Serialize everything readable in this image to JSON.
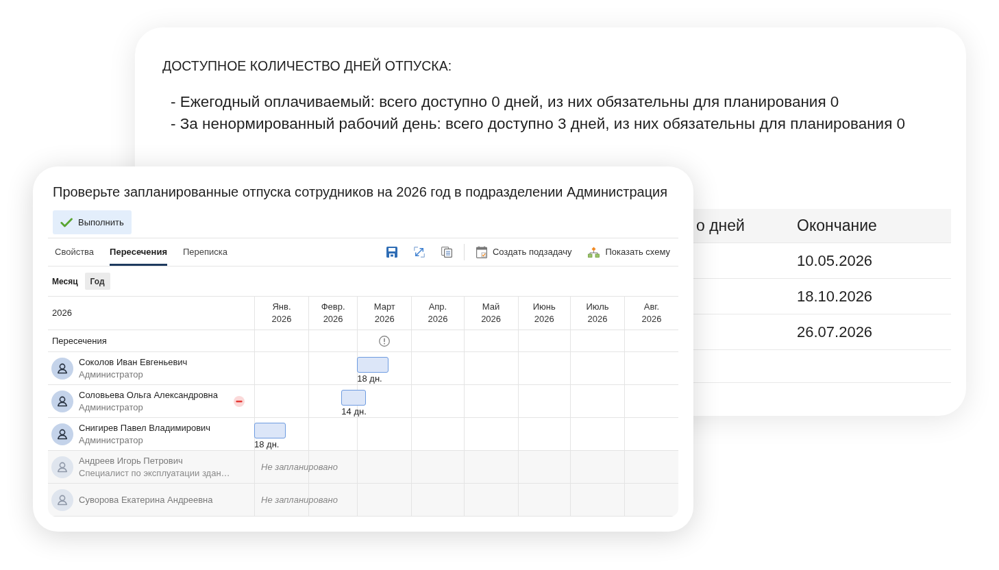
{
  "background_card": {
    "heading": "ДОСТУПНОЕ КОЛИЧЕСТВО ДНЕЙ ОТПУСКА:",
    "lines": [
      "- Ежегодный оплачиваемый: всего доступно 0 дней, из них обязательны для планирования 0",
      "- За ненормированный рабочий день: всего доступно 3 дней, из них обязательны для планирования 0"
    ],
    "table": {
      "columns": [
        "о дней",
        "Окончание"
      ],
      "rows": [
        {
          "ending": "10.05.2026"
        },
        {
          "ending": "18.10.2026"
        },
        {
          "ending": "26.07.2026"
        }
      ]
    }
  },
  "task_card": {
    "title": "Проверьте запланированные отпуска сотрудников на 2026 год в подразделении Администрация",
    "complete_button": "Выполнить",
    "tabs": [
      {
        "label": "Свойства",
        "selected": false
      },
      {
        "label": "Пересечения",
        "selected": true
      },
      {
        "label": "Переписка",
        "selected": false
      }
    ],
    "toolbar_actions": [
      {
        "label": "Создать подзадачу"
      },
      {
        "label": "Показать схему"
      }
    ],
    "view_modes": [
      {
        "label": "Месяц",
        "selected": false
      },
      {
        "label": "Год",
        "selected": true
      }
    ],
    "grid": {
      "year": "2026",
      "months": [
        {
          "lines": [
            "Янв.",
            "2026"
          ]
        },
        {
          "lines": [
            "Февр.",
            "2026"
          ]
        },
        {
          "lines": [
            "Март",
            "2026"
          ]
        },
        {
          "lines": [
            "Апр.",
            "2026"
          ]
        },
        {
          "lines": [
            "Май",
            "2026"
          ]
        },
        {
          "lines": [
            "Июнь",
            "2026"
          ]
        },
        {
          "lines": [
            "Июль",
            "2026"
          ]
        },
        {
          "lines": [
            "Авг.",
            "2026"
          ]
        }
      ],
      "intersections": {
        "label": "Пересечения",
        "cells": [
          {
            "warning": false
          },
          {
            "warning": false
          },
          {
            "warning": true
          },
          {
            "warning": false
          },
          {
            "warning": false
          },
          {
            "warning": false
          },
          {
            "warning": false
          },
          {
            "warning": false
          }
        ]
      },
      "employees": [
        {
          "name": "Соколов Иван Евгеньевич",
          "role": "Администратор",
          "disabled": false,
          "excluded": false,
          "vacations": [
            {
              "label": "18 дн."
            }
          ]
        },
        {
          "name": "Соловьева Ольга Александровна",
          "role": "Администратор",
          "disabled": false,
          "excluded": true,
          "vacations": [
            {
              "label": "14 дн."
            }
          ]
        },
        {
          "name": "Снигирев Павел Владимирович",
          "role": "Администратор",
          "disabled": false,
          "excluded": false,
          "vacations": [
            {
              "label": "18 дн."
            }
          ]
        },
        {
          "name": "Андреев Игорь Петрович",
          "role": "Специалист по эксплуатации здан…",
          "disabled": true,
          "excluded": false,
          "note": "Не запланировано"
        },
        {
          "name": "Суворова Екатерина Андреевна",
          "disabled": true,
          "excluded": false,
          "note": "Не запланировано"
        }
      ]
    }
  }
}
